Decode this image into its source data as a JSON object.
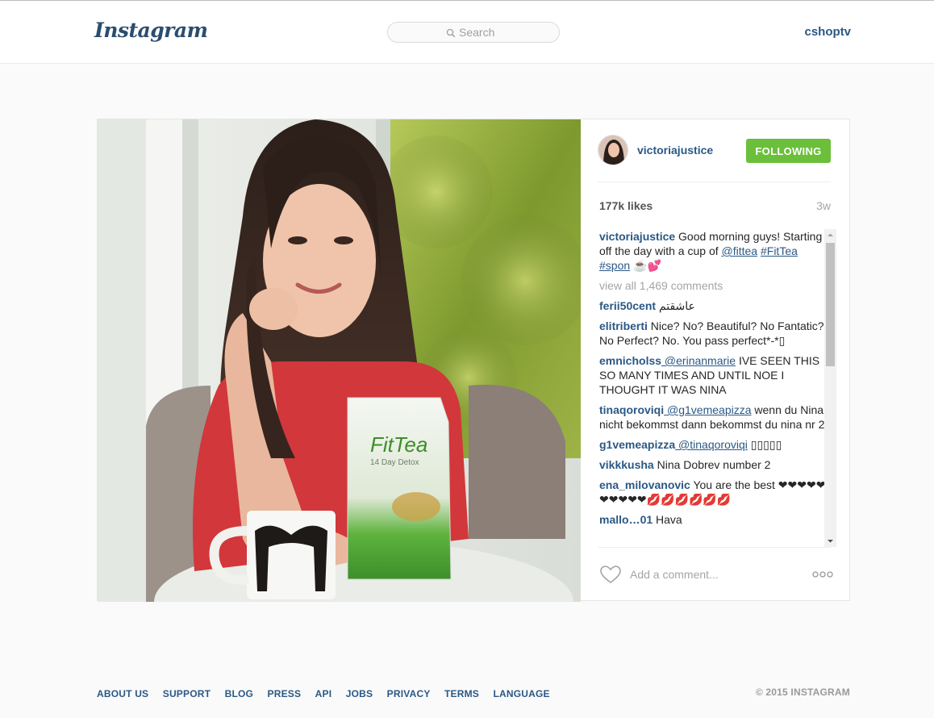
{
  "header": {
    "logo": "Instagram",
    "search_placeholder": "Search",
    "current_user": "cshoptv"
  },
  "post": {
    "owner": "victoriajustice",
    "follow_label": "FOLLOWING",
    "likes": "177k likes",
    "age": "3w",
    "caption": {
      "user": "victoriajustice",
      "text_1": " Good morning guys! Starting off the day with a cup of ",
      "mention": "@fittea",
      "tags": "#FitTea #spon",
      "emoji": " ☕💕"
    },
    "view_all_comments": "view all 1,469 comments",
    "comments": [
      {
        "user": "ferii50cent",
        "mention": "",
        "text": " عاشقتم"
      },
      {
        "user": "elitriberti",
        "mention": "",
        "text": " Nice? No? Beautiful? No Fantatic? No Perfect? No. You pass perfect*-*▯"
      },
      {
        "user": "emnicholss",
        "mention": " @erinanmarie",
        "text": " IVE SEEN THIS SO MANY TIMES AND UNTIL NOE I THOUGHT IT WAS NINA"
      },
      {
        "user": "tinaqoroviqi",
        "mention": " @g1vemeapizza",
        "text": " wenn du Nina nicht bekommst dann bekommst du nina nr 2"
      },
      {
        "user": "g1vemeapizza",
        "mention": " @tinaqoroviqi",
        "text": " ▯▯▯▯▯"
      },
      {
        "user": "vikkkusha",
        "mention": "",
        "text": " Nina Dobrev number 2"
      },
      {
        "user": "ena_milovanovic",
        "mention": "",
        "text": " You are the best ❤❤❤❤❤❤❤❤❤❤💋💋💋💋💋💋"
      },
      {
        "user": "mallo…01",
        "mention": "",
        "text": " Hava"
      }
    ],
    "comment_placeholder": "Add a comment...",
    "product_brand": "FitTea",
    "product_sub": "14 Day Detox"
  },
  "footer": {
    "links": [
      "ABOUT US",
      "SUPPORT",
      "BLOG",
      "PRESS",
      "API",
      "JOBS",
      "PRIVACY",
      "TERMS",
      "LANGUAGE"
    ],
    "copyright": "© 2015 INSTAGRAM"
  },
  "colors": {
    "link": "#2a5885",
    "follow_button": "#6bbf3b",
    "background": "#fafafa"
  },
  "icons": {
    "search": "search-icon",
    "like": "heart-outline-icon",
    "more": "more-options-icon"
  }
}
